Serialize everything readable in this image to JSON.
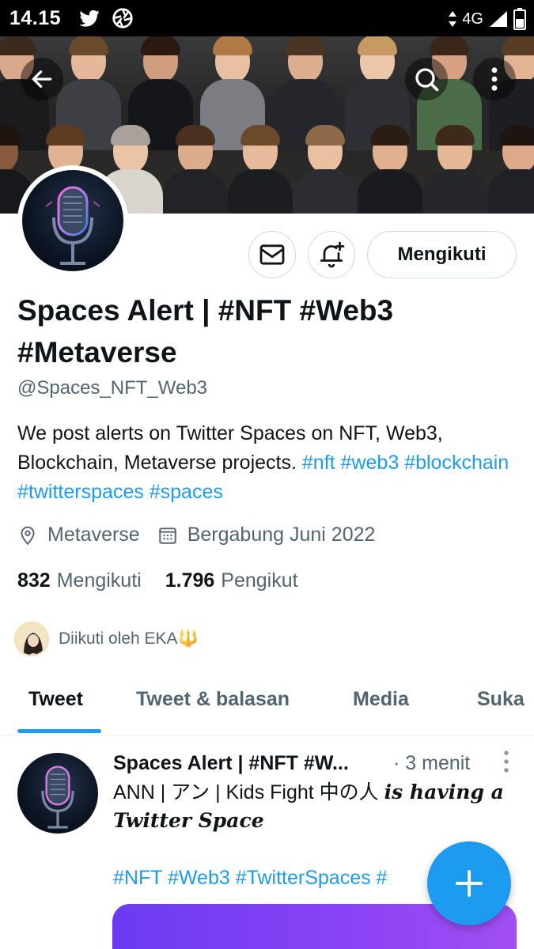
{
  "status_bar": {
    "time": "14.15",
    "network": "4G"
  },
  "profile": {
    "name": "Spaces Alert | #NFT #Web3 #Metaverse",
    "handle": "@Spaces_NFT_Web3",
    "bio_text": "We post alerts on Twitter Spaces on NFT, Web3, Blockchain, Metaverse projects.",
    "bio_hashtags": [
      "#nft",
      "#web3",
      "#blockchain",
      "#twitterspaces",
      "#spaces"
    ],
    "location": "Metaverse",
    "joined": "Bergabung Juni 2022",
    "following_count": "832",
    "following_label": "Mengikuti",
    "followers_count": "1.796",
    "followers_label": "Pengikut",
    "followed_by": "Diikuti oleh EKA🔱"
  },
  "actions": {
    "follow_label": "Mengikuti"
  },
  "tabs": [
    {
      "label": "Tweet",
      "active": true
    },
    {
      "label": "Tweet & balasan",
      "active": false
    },
    {
      "label": "Media",
      "active": false
    },
    {
      "label": "Suka",
      "active": false
    }
  ],
  "tweet": {
    "author": "Spaces Alert | #NFT #W...",
    "time": "· 3 menit",
    "text_plain": "ANN | アン | Kids Fight 中の人",
    "text_fancy_1": "is having a",
    "text_fancy_2": "Twitter Space",
    "hashtags": "#NFT #Web3 #TwitterSpaces #"
  },
  "colors": {
    "accent": "#1d9bf0",
    "secondary_text": "#536471",
    "primary_text": "#0f1419"
  },
  "icons": [
    "back-arrow-icon",
    "search-icon",
    "more-vertical-icon",
    "mail-icon",
    "bell-plus-icon",
    "location-icon",
    "calendar-icon",
    "plus-icon"
  ]
}
